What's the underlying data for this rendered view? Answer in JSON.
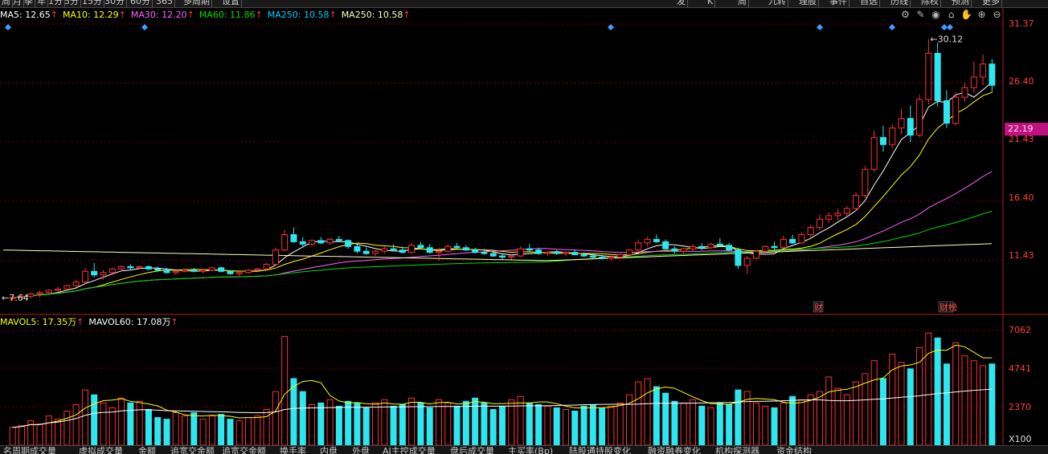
{
  "top_tabs": [
    "周",
    "月",
    "季",
    "年",
    "1分",
    "5分",
    "15分",
    "30分",
    "60分",
    "365",
    "多周期",
    "设置",
    "发",
    "K",
    "周",
    "九转",
    "理股",
    "事件",
    "自选",
    "历线",
    "除权",
    "预测",
    "更多"
  ],
  "ma_legend": [
    {
      "label": "MA5: 12.65",
      "color": "#ffffff"
    },
    {
      "label": "MA10: 12.29",
      "color": "#ffff00"
    },
    {
      "label": "MA30: 12.20",
      "color": "#ff60ff"
    },
    {
      "label": "MA60: 11.86",
      "color": "#00dd00"
    },
    {
      "label": "MA250: 10.58",
      "color": "#00cfff"
    },
    {
      "label": "MA250: 10.58",
      "color": "#ffffc0"
    }
  ],
  "tool_icons": [
    "gear-icon",
    "pencil-icon",
    "eye-icon",
    "house-icon",
    "hand-icon",
    "zoom-in-icon",
    "zoom-out-icon"
  ],
  "price_axis": [
    "31.37",
    "26.40",
    "21.43",
    "16.40",
    "11.43"
  ],
  "current_price": "22.19",
  "max_label": "30.12",
  "min_label": "7.64",
  "markers": [
    "财",
    "财榜"
  ],
  "vol_legend": [
    {
      "label": "MAVOL5: 17.35万",
      "color": "#ffff00"
    },
    {
      "label": "MAVOL60: 17.08万",
      "color": "#ffffff"
    }
  ],
  "vol_axis": [
    "7062",
    "4741",
    "2370"
  ],
  "vol_unit": "X100",
  "bottom_tabs": [
    "名周期成交量",
    "虚拟成交量",
    "金额",
    "追宽交金额",
    "追宽交金额",
    "换手率",
    "内盘",
    "外盘",
    "AI主控成交量",
    "盘后成交量",
    "主买率(Bp)",
    "陆股通持股变化",
    "融资融券变化",
    "机构探测器",
    "资金结构"
  ],
  "chart_data": {
    "type": "candlestick",
    "price_ylim": [
      7.0,
      31.37
    ],
    "volume_ylim": [
      0,
      7062
    ],
    "max_price": 30.12,
    "min_price": 7.64,
    "candles": [
      [
        8.2,
        8.4,
        8.0,
        8.3
      ],
      [
        8.3,
        8.6,
        8.1,
        8.4
      ],
      [
        8.4,
        8.7,
        8.2,
        8.6
      ],
      [
        8.6,
        8.9,
        8.3,
        8.7
      ],
      [
        8.7,
        9.0,
        8.6,
        8.9
      ],
      [
        8.9,
        9.2,
        8.8,
        9.0
      ],
      [
        9.0,
        9.4,
        8.9,
        9.3
      ],
      [
        9.3,
        9.8,
        9.1,
        9.6
      ],
      [
        9.6,
        10.8,
        9.5,
        10.5
      ],
      [
        10.5,
        11.2,
        10.0,
        10.2
      ],
      [
        10.2,
        10.6,
        9.8,
        10.4
      ],
      [
        10.4,
        10.8,
        10.2,
        10.7
      ],
      [
        10.7,
        11.0,
        10.5,
        10.9
      ],
      [
        10.9,
        11.1,
        10.6,
        10.8
      ],
      [
        10.8,
        11.0,
        10.7,
        10.9
      ],
      [
        10.9,
        11.0,
        10.6,
        10.7
      ],
      [
        10.7,
        10.9,
        10.5,
        10.6
      ],
      [
        10.6,
        10.8,
        10.3,
        10.4
      ],
      [
        10.4,
        10.6,
        10.2,
        10.5
      ],
      [
        10.5,
        10.7,
        10.4,
        10.6
      ],
      [
        10.6,
        10.8,
        10.4,
        10.5
      ],
      [
        10.5,
        10.7,
        10.3,
        10.6
      ],
      [
        10.6,
        10.9,
        10.5,
        10.8
      ],
      [
        10.8,
        10.9,
        10.4,
        10.5
      ],
      [
        10.5,
        10.6,
        10.2,
        10.3
      ],
      [
        10.3,
        10.5,
        10.1,
        10.4
      ],
      [
        10.4,
        10.7,
        10.3,
        10.6
      ],
      [
        10.6,
        10.8,
        10.5,
        10.7
      ],
      [
        10.7,
        11.2,
        10.6,
        11.1
      ],
      [
        11.1,
        12.5,
        11.0,
        12.3
      ],
      [
        12.3,
        14.0,
        12.2,
        13.6
      ],
      [
        13.6,
        14.2,
        12.9,
        13.0
      ],
      [
        13.0,
        13.4,
        12.5,
        12.8
      ],
      [
        12.8,
        13.2,
        12.6,
        13.1
      ],
      [
        13.1,
        13.4,
        12.8,
        12.9
      ],
      [
        12.9,
        13.3,
        12.7,
        13.2
      ],
      [
        13.2,
        13.5,
        13.0,
        13.1
      ],
      [
        13.1,
        13.2,
        12.4,
        12.6
      ],
      [
        12.6,
        12.8,
        12.0,
        12.2
      ],
      [
        12.2,
        12.5,
        11.9,
        12.0
      ],
      [
        12.0,
        12.3,
        11.8,
        12.2
      ],
      [
        12.2,
        12.6,
        12.0,
        12.4
      ],
      [
        12.4,
        12.8,
        12.2,
        12.3
      ],
      [
        12.3,
        12.6,
        12.0,
        12.1
      ],
      [
        12.1,
        12.9,
        12.0,
        12.7
      ],
      [
        12.7,
        13.0,
        12.4,
        12.5
      ],
      [
        12.5,
        12.8,
        12.0,
        12.1
      ],
      [
        12.1,
        12.5,
        11.4,
        12.2
      ],
      [
        12.2,
        12.8,
        12.1,
        12.6
      ],
      [
        12.6,
        12.9,
        12.4,
        12.5
      ],
      [
        12.5,
        12.7,
        12.2,
        12.3
      ],
      [
        12.3,
        12.5,
        12.0,
        12.1
      ],
      [
        12.1,
        12.4,
        11.9,
        12.0
      ],
      [
        12.0,
        12.2,
        11.7,
        11.8
      ],
      [
        11.8,
        12.0,
        11.5,
        11.7
      ],
      [
        11.7,
        11.9,
        11.5,
        11.8
      ],
      [
        11.8,
        12.6,
        11.7,
        12.4
      ],
      [
        12.4,
        12.8,
        12.2,
        12.3
      ],
      [
        12.3,
        12.5,
        11.9,
        12.0
      ],
      [
        12.0,
        12.2,
        11.8,
        12.1
      ],
      [
        12.1,
        12.3,
        11.9,
        12.0
      ],
      [
        12.0,
        12.2,
        11.8,
        12.1
      ],
      [
        12.1,
        12.3,
        11.9,
        11.9
      ],
      [
        11.9,
        12.1,
        11.7,
        11.8
      ],
      [
        11.8,
        12.0,
        11.6,
        11.7
      ],
      [
        11.7,
        11.9,
        11.5,
        11.6
      ],
      [
        11.6,
        11.8,
        11.4,
        11.7
      ],
      [
        11.7,
        12.0,
        11.6,
        11.9
      ],
      [
        11.9,
        12.4,
        11.8,
        12.3
      ],
      [
        12.3,
        13.2,
        12.2,
        12.9
      ],
      [
        12.9,
        13.4,
        12.6,
        13.2
      ],
      [
        13.2,
        13.6,
        12.9,
        13.0
      ],
      [
        13.0,
        13.2,
        12.3,
        12.4
      ],
      [
        12.4,
        12.6,
        12.0,
        12.2
      ],
      [
        12.2,
        12.5,
        12.0,
        12.4
      ],
      [
        12.4,
        12.8,
        12.2,
        12.6
      ],
      [
        12.6,
        12.9,
        12.3,
        12.5
      ],
      [
        12.5,
        12.9,
        12.4,
        12.8
      ],
      [
        12.8,
        13.3,
        12.6,
        12.7
      ],
      [
        12.7,
        12.9,
        12.2,
        12.3
      ],
      [
        12.3,
        12.5,
        10.7,
        11.0
      ],
      [
        11.0,
        11.8,
        10.3,
        11.6
      ],
      [
        11.6,
        12.3,
        11.5,
        12.2
      ],
      [
        12.2,
        12.7,
        12.0,
        12.6
      ],
      [
        12.6,
        13.0,
        12.3,
        12.5
      ],
      [
        12.5,
        13.5,
        12.4,
        13.2
      ],
      [
        13.2,
        13.6,
        12.8,
        12.9
      ],
      [
        12.9,
        13.8,
        12.8,
        13.6
      ],
      [
        13.6,
        14.4,
        13.3,
        14.2
      ],
      [
        14.2,
        15.3,
        14.0,
        14.9
      ],
      [
        14.9,
        15.5,
        14.6,
        15.2
      ],
      [
        15.2,
        15.8,
        14.8,
        15.4
      ],
      [
        15.4,
        16.0,
        15.1,
        15.8
      ],
      [
        15.8,
        17.2,
        15.6,
        16.9
      ],
      [
        16.9,
        19.4,
        16.7,
        19.1
      ],
      [
        19.1,
        22.4,
        18.9,
        21.8
      ],
      [
        21.8,
        22.8,
        20.6,
        21.2
      ],
      [
        21.2,
        22.9,
        20.9,
        22.6
      ],
      [
        22.6,
        24.2,
        22.1,
        23.4
      ],
      [
        23.4,
        24.5,
        21.4,
        22.0
      ],
      [
        22.0,
        25.4,
        21.8,
        25.0
      ],
      [
        25.0,
        30.1,
        24.6,
        28.9
      ],
      [
        28.9,
        29.8,
        24.4,
        24.9
      ],
      [
        24.9,
        25.8,
        22.6,
        23.0
      ],
      [
        23.0,
        25.6,
        22.8,
        25.2
      ],
      [
        25.2,
        26.4,
        24.8,
        26.0
      ],
      [
        26.0,
        28.2,
        25.6,
        26.9
      ],
      [
        26.9,
        28.8,
        26.2,
        28.0
      ],
      [
        28.0,
        28.4,
        25.6,
        26.2
      ]
    ],
    "volumes": [
      1100,
      1200,
      1500,
      1300,
      1800,
      1600,
      2100,
      2500,
      3400,
      3100,
      2600,
      2300,
      2900,
      2600,
      2700,
      2200,
      1700,
      1600,
      2000,
      1800,
      2000,
      1600,
      1800,
      1900,
      1600,
      1500,
      1700,
      1800,
      2200,
      3300,
      6700,
      4100,
      3300,
      2500,
      2600,
      2800,
      2400,
      2700,
      2600,
      2300,
      2600,
      2800,
      2400,
      2500,
      2900,
      2600,
      2300,
      2800,
      2600,
      2400,
      2700,
      2900,
      2600,
      2200,
      2400,
      2800,
      3000,
      2600,
      2500,
      2400,
      2300,
      2200,
      2100,
      2400,
      2500,
      2300,
      2400,
      2600,
      3100,
      3900,
      4100,
      3600,
      3200,
      2700,
      2600,
      2800,
      2400,
      2300,
      2600,
      2500,
      3400,
      3300,
      2600,
      2400,
      2300,
      2600,
      3000,
      2800,
      3100,
      3300,
      4200,
      3500,
      3100,
      3900,
      4400,
      5200,
      4100,
      5600,
      5100,
      4700,
      6000,
      6900,
      6600,
      5000,
      6300,
      5500,
      5200,
      4900,
      5000
    ],
    "ma_lines": {
      "ma5": {
        "color": "#ffffff",
        "start": 8.3,
        "end": 26.7
      },
      "ma10": {
        "color": "#ffff00",
        "start": 8.2,
        "end": 25.6
      },
      "ma30": {
        "color": "#ff60ff",
        "start": 8.0,
        "end": 21.0
      },
      "ma60": {
        "color": "#00dd00",
        "start": 7.9,
        "end": 16.9
      },
      "ma250": {
        "color": "#ffffc0",
        "start": 12.3,
        "end": 11.9
      }
    },
    "mavol5_color": "#ffff00",
    "mavol60_color": "#ffffff"
  }
}
